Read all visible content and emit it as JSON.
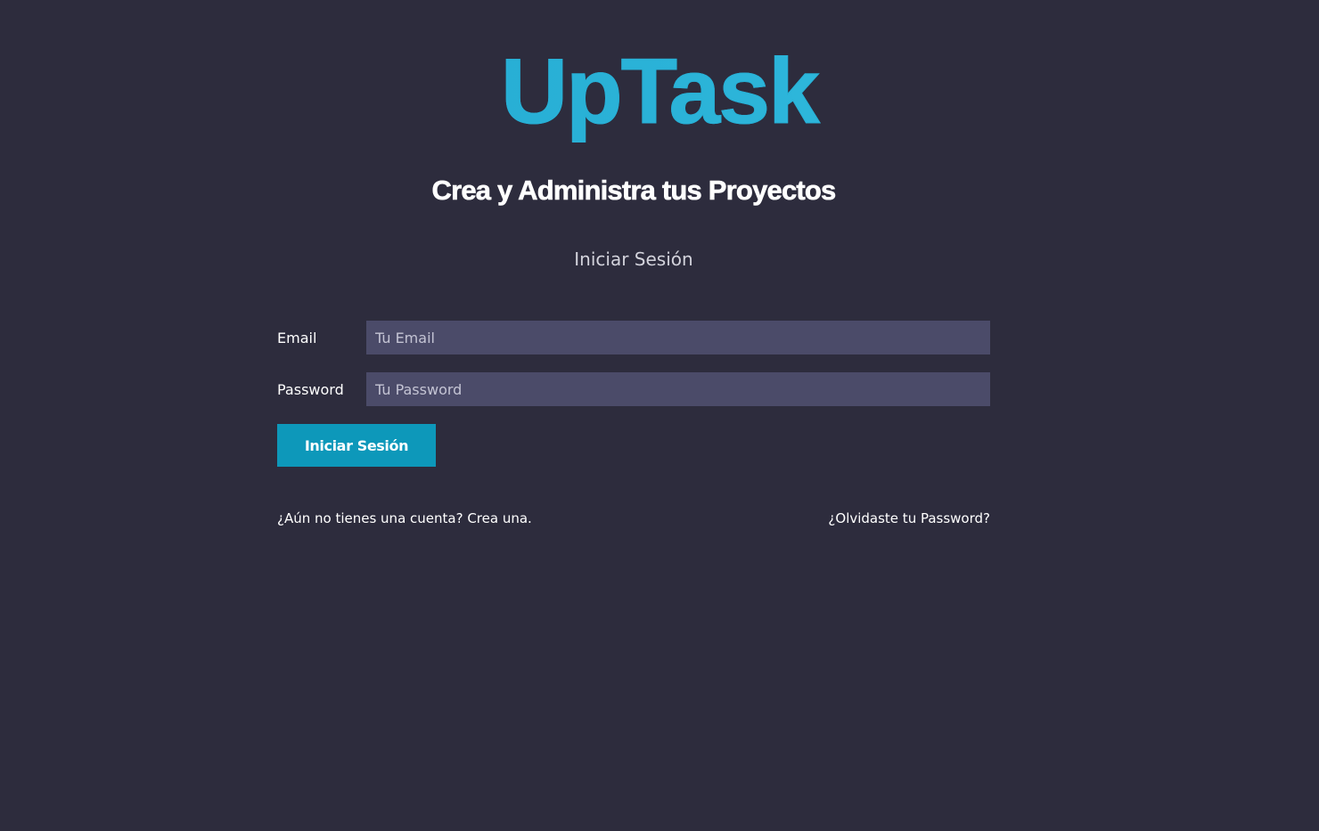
{
  "brand": {
    "name": "UpTask",
    "color_start": "#1fa4cc",
    "color_end": "#36c1e3"
  },
  "tagline": "Crea y Administra tus Proyectos",
  "page_description": "Iniciar Sesión",
  "form": {
    "email_label": "Email",
    "email_placeholder": "Tu Email",
    "email_value": "",
    "password_label": "Password",
    "password_placeholder": "Tu Password",
    "password_value": "",
    "submit_label": "Iniciar Sesión"
  },
  "actions": {
    "create_account": "¿Aún no tienes una cuenta? Crea una.",
    "forgot_password": "¿Olvidaste tu Password?"
  },
  "colors": {
    "background": "#2d2c3d",
    "input_background": "#4b4b69",
    "button": "#0d98ba"
  }
}
